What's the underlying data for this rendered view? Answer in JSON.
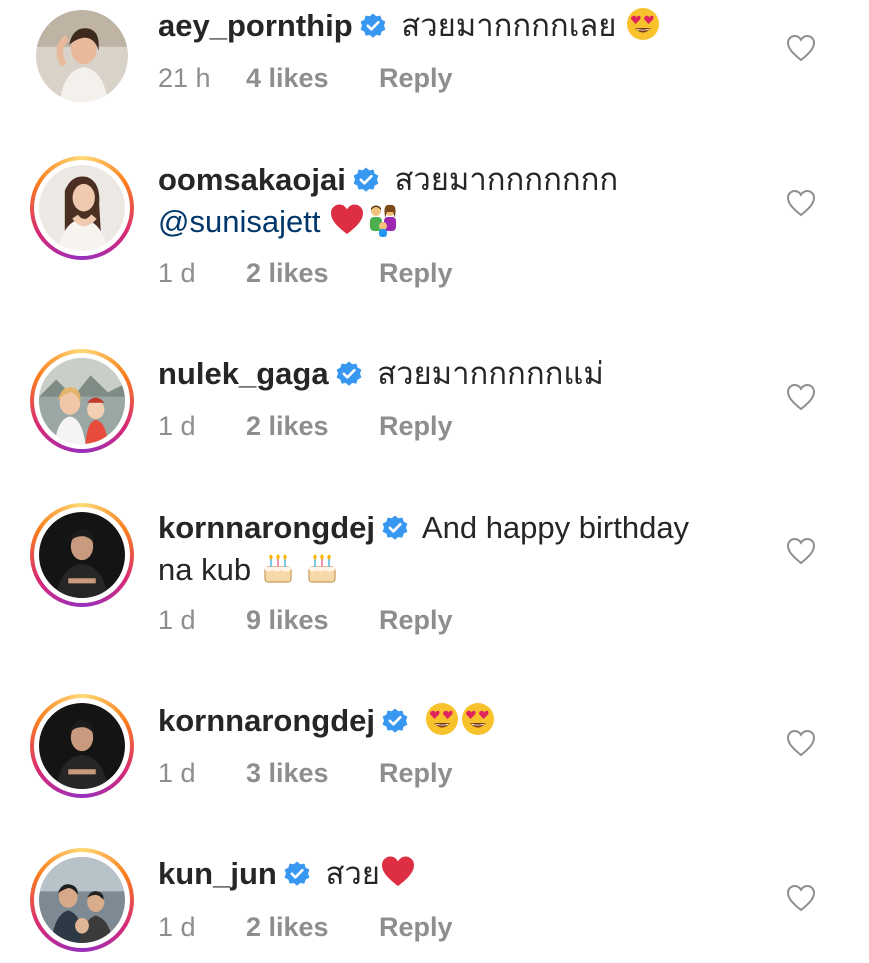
{
  "comments": [
    {
      "username": "aey_pornthip",
      "text": "สวยมากกกกเลย",
      "time": "21 h",
      "likes": "4 likes",
      "reply": "Reply"
    },
    {
      "username": "oomsakaojai",
      "text": "สวยมากกกกกกก",
      "mention": "@sunisajett",
      "time": "1 d",
      "likes": "2 likes",
      "reply": "Reply"
    },
    {
      "username": "nulek_gaga",
      "text": "สวยมากกกกกแม่",
      "time": "1 d",
      "likes": "2 likes",
      "reply": "Reply"
    },
    {
      "username": "kornnarongdej",
      "text": "And happy birthday",
      "text2": "na kub",
      "time": "1 d",
      "likes": "9 likes",
      "reply": "Reply"
    },
    {
      "username": "kornnarongdej",
      "text": "",
      "time": "1 d",
      "likes": "3 likes",
      "reply": "Reply"
    },
    {
      "username": "kun_jun",
      "text": "สวย",
      "time": "1 d",
      "likes": "2 likes",
      "reply": "Reply"
    }
  ],
  "icons": {
    "verified": "verified-badge-icon",
    "like": "heart-outline-icon",
    "emoji_heart_eyes": "heart-eyes-emoji",
    "emoji_red_heart": "red-heart-emoji",
    "emoji_family": "family-emoji",
    "emoji_cake": "birthday-cake-emoji"
  },
  "colors": {
    "text": "#262626",
    "muted": "#8e8e8e",
    "verified": "#3897f0",
    "mention": "#00376b",
    "story_ring_start": "#feda75",
    "story_ring_end": "#d62976"
  }
}
